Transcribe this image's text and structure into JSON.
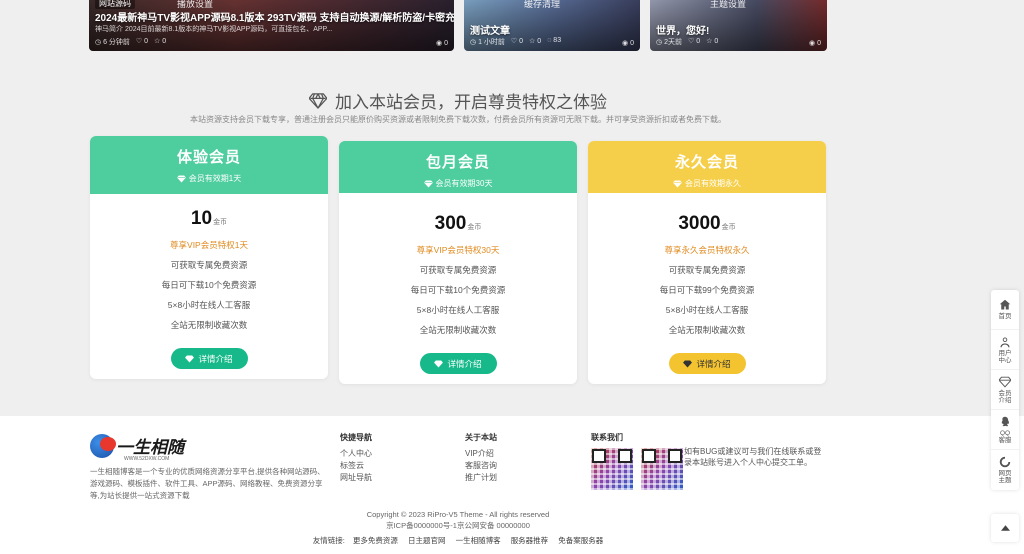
{
  "posts": [
    {
      "category": "网站源码",
      "top_tag": "播放设置",
      "title": "2024最新神马TV影视APP源码8.1版本 293TV源码 支持自动换源/解析防盗/卡密充值/",
      "excerpt": "神马简介 2024目前最新8.1版本的神马TV影视APP源码，可直接包名、APP...",
      "meta": [
        "6 分钟前",
        "0",
        "0"
      ],
      "views": "0"
    },
    {
      "top_tag": "缓存清理",
      "title": "测试文章",
      "meta": [
        "1 小时前",
        "0",
        "0",
        "83"
      ],
      "views": "0"
    },
    {
      "top_tag": "主题设置",
      "title": "世界，您好!",
      "meta": [
        "2天前",
        "0",
        "0"
      ],
      "views": "0"
    }
  ],
  "vip": {
    "heading": "加入本站会员，开启尊贵特权之体验",
    "subheading": "本站资源支持会员下载专享，普通注册会员只能原价购买资源或者限制免费下载次数，付费会员所有资源可无限下载。并可享受资源折扣或者免费下载。",
    "plans": [
      {
        "name": "体验会员",
        "validity": "会员有效期1天",
        "price": "10",
        "unit": "金币",
        "perk": "尊享VIP会员特权1天",
        "features": [
          "可获取专属免费资源",
          "每日可下载10个免费资源",
          "5×8小时在线人工客服",
          "全站无限制收藏次数"
        ],
        "button": "详情介绍"
      },
      {
        "name": "包月会员",
        "validity": "会员有效期30天",
        "price": "300",
        "unit": "金币",
        "perk": "尊享VIP会员特权30天",
        "features": [
          "可获取专属免费资源",
          "每日可下载10个免费资源",
          "5×8小时在线人工客服",
          "全站无限制收藏次数"
        ],
        "button": "详情介绍"
      },
      {
        "name": "永久会员",
        "validity": "会员有效期永久",
        "price": "3000",
        "unit": "金币",
        "perk": "尊享永久会员特权永久",
        "features": [
          "可获取专属免费资源",
          "每日可下载99个免费资源",
          "5×8小时在线人工客服",
          "全站无限制收藏次数"
        ],
        "button": "详情介绍"
      }
    ]
  },
  "footer": {
    "logo_text": "一生相随",
    "logo_url": "WWW.52DXW.COM",
    "about": "一生相随博客是一个专业的优质网络资源分享平台,提供各种网站源码、游戏源码、模板插件、软件工具、APP源码、网络教程、免费资源分享等,为站长提供一站式资源下载",
    "nav_title": "快捷导航",
    "nav_links": [
      "个人中心",
      "标签云",
      "网址导航"
    ],
    "about_title": "关于本站",
    "about_links": [
      "VIP介绍",
      "客服咨询",
      "推广计划"
    ],
    "contact_title": "联系我们",
    "contact_note": "如有BUG或建议可与我们在线联系或登录本站账号进入个人中心提交工单。",
    "copyright": "Copyright © 2023 RiPro-V5 Theme - All rights reserved",
    "icp": "京ICP备0000000号-1京公网安备 00000000",
    "friend_label": "友情链接:",
    "friend_links": [
      "更多免费资源",
      "日主题官网",
      "一生相随博客",
      "服务器推荐",
      "免备案服务器"
    ]
  },
  "sidebar": {
    "items": [
      {
        "label": "首页",
        "icon": "home-icon"
      },
      {
        "label": "用户中心",
        "icon": "user-icon"
      },
      {
        "label": "会员介绍",
        "icon": "diamond-icon"
      },
      {
        "label": "QQ客服",
        "icon": "qq-icon"
      },
      {
        "label": "网页主题",
        "icon": "theme-icon"
      }
    ],
    "back_to_top": "chevron-up-icon"
  },
  "colors": {
    "green": "#4ecd9f",
    "green_button": "#17b98a",
    "gold": "#f6cf4a",
    "perk_orange": "#e08a1e"
  }
}
